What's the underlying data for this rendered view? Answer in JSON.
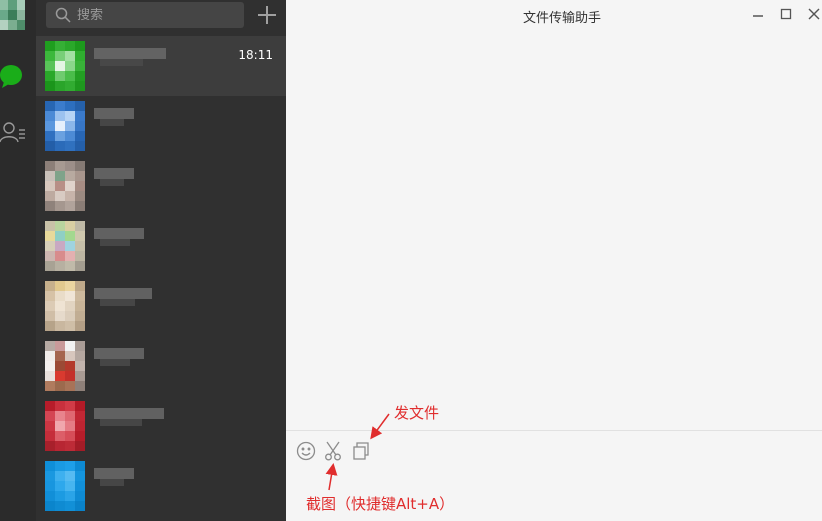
{
  "window": {
    "title": "文件传输助手",
    "controls": [
      "minimize-icon",
      "maximize-icon",
      "close-icon"
    ]
  },
  "nav": {
    "items": [
      {
        "name": "chat",
        "icon": "chat-bubble-icon",
        "active": true
      },
      {
        "name": "contacts",
        "icon": "contacts-icon",
        "active": false
      }
    ]
  },
  "search": {
    "placeholder": "搜索",
    "value": ""
  },
  "chat_list": [
    {
      "time": "18:11",
      "active": true
    },
    {
      "time": ""
    },
    {
      "time": ""
    },
    {
      "time": ""
    },
    {
      "time": ""
    },
    {
      "time": ""
    },
    {
      "time": ""
    },
    {
      "time": ""
    }
  ],
  "toolbar": {
    "items": [
      "emoji-icon",
      "screenshot-scissors-icon",
      "send-file-icon"
    ]
  },
  "annotations": {
    "send_file": "发文件",
    "screenshot": "截图（快捷键Alt+A）",
    "color": "#e02d2d"
  },
  "colors": {
    "accent_green": "#1aad19",
    "sidebar": "#2b2b2b",
    "list_bg": "#303030",
    "list_active": "#3d3d3d",
    "main_bg": "#f5f5f5"
  }
}
